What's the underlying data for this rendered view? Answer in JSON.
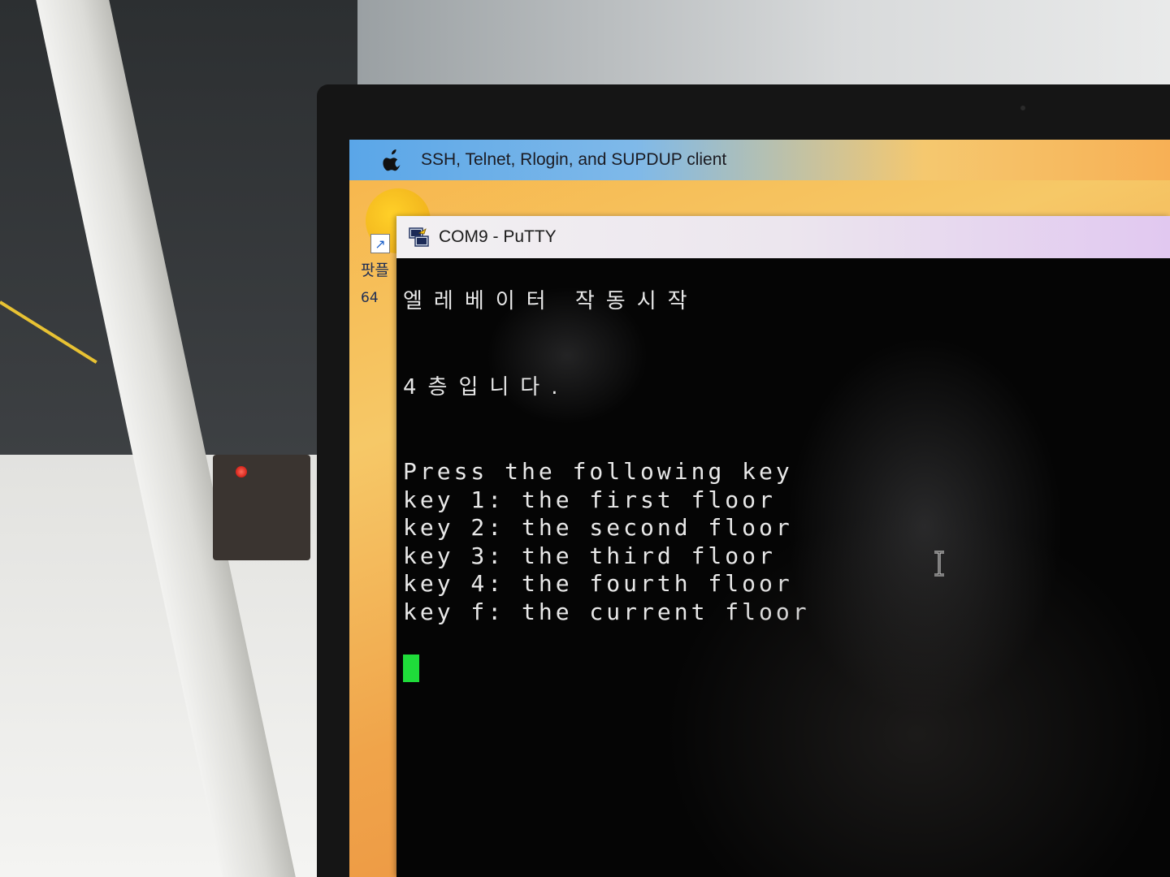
{
  "menubar": {
    "apple_icon": "apple-icon",
    "title": "SSH, Telnet, Rlogin, and SUPDUP client"
  },
  "desktop": {
    "icon_label_line1": "팟플",
    "icon_label_line2": "64"
  },
  "window": {
    "title": "COM9 - PuTTY",
    "icon": "putty-icon"
  },
  "terminal": {
    "line1": "엘레베이터 작동시작",
    "line2": "4층입니다.",
    "line3": "Press the following key",
    "line4": "key 1: the first floor",
    "line5": "key 2: the second floor",
    "line6": "key 3: the third floor",
    "line7": "key 4: the fourth floor",
    "line8": "key f: the current floor",
    "cursor_color": "#1fdc3a"
  }
}
